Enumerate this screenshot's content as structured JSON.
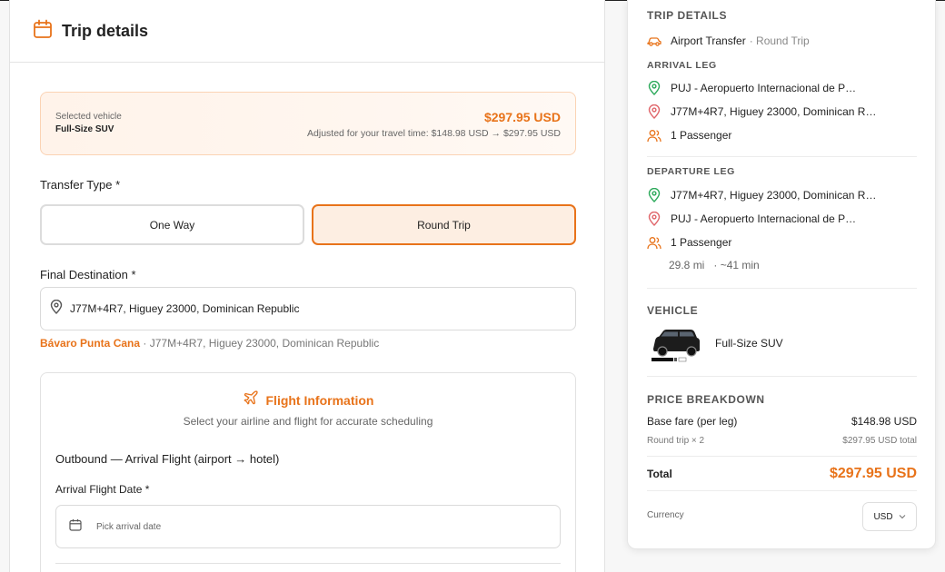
{
  "trip_form": {
    "title": "Trip details",
    "selected_vehicle": {
      "label": "Selected vehicle",
      "name": "Full-Size SUV",
      "price": "$297.95 USD",
      "adjustment": "Adjusted for your travel time: $148.98 USD → $297.95 USD"
    },
    "transfer_type": {
      "label": "Transfer Type *",
      "options": [
        "One Way",
        "Round Trip"
      ],
      "selected": "Round Trip"
    },
    "final_destination": {
      "label": "Final Destination *",
      "value": "J77M+4R7, Higuey 23000, Dominican Republic",
      "hint_brand": "Bávaro Punta Cana",
      "hint_address": "· J77M+4R7, Higuey 23000, Dominican Republic"
    },
    "flight_info": {
      "title": "Flight Information",
      "subtitle": "Select your airline and flight for accurate scheduling",
      "outbound_label": "Outbound — Arrival Flight (airport → hotel)",
      "date_label": "Arrival Flight Date *",
      "date_placeholder": "Pick arrival date"
    }
  },
  "summary": {
    "trip_heading": "TRIP DETAILS",
    "service": "Airport Transfer",
    "trip_kind": "· Round Trip",
    "arrival_heading": "ARRIVAL LEG",
    "arrival": {
      "from": "PUJ - Aeropuerto Internacional de P…",
      "to": "J77M+4R7, Higuey 23000, Dominican R…",
      "passengers": "1 Passenger"
    },
    "departure_heading": "DEPARTURE LEG",
    "departure": {
      "from": "J77M+4R7, Higuey 23000, Dominican R…",
      "to": "PUJ - Aeropuerto Internacional de P…",
      "passengers": "1 Passenger",
      "distance": "29.8 mi",
      "duration": "· ~41 min"
    },
    "vehicle_heading": "VEHICLE",
    "vehicle_name": "Full-Size SUV",
    "price_heading": "PRICE BREAKDOWN",
    "base_fare_label": "Base fare (per leg)",
    "base_fare_value": "$148.98 USD",
    "round_trip_label": "Round trip × 2",
    "round_trip_value": "$297.95 USD total",
    "total_label": "Total",
    "total_value": "$297.95 USD",
    "currency_label": "Currency",
    "currency_value": "USD"
  },
  "icons": {
    "calendar": "calendar-icon",
    "pin": "map-pin-icon",
    "plane": "plane-icon",
    "car": "car-icon",
    "users": "users-icon",
    "chevron": "chevron-down-icon"
  },
  "colors": {
    "accent": "#e8731a",
    "pickup_pin": "#2eaa5c",
    "dropoff_pin": "#e0666b"
  }
}
